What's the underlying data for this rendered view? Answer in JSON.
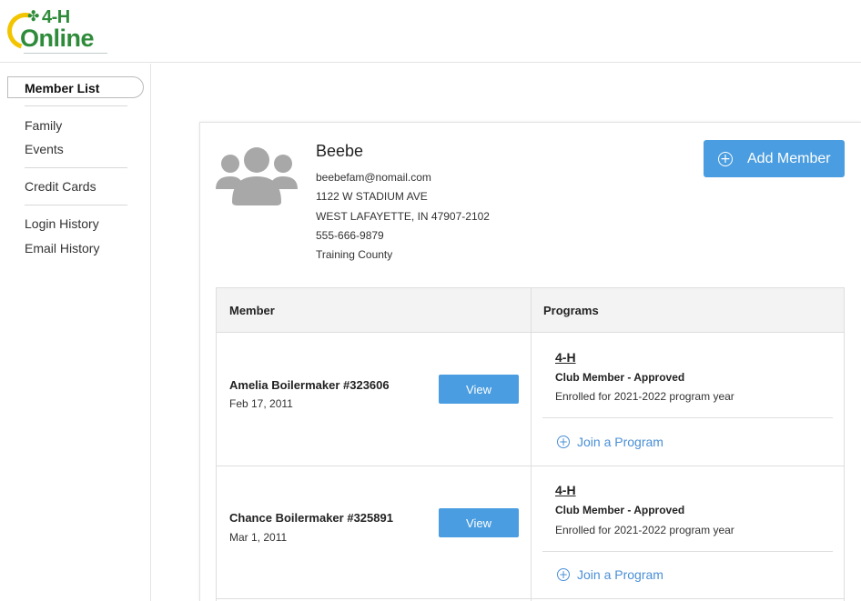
{
  "header": {
    "logo_text_top": "4-H",
    "logo_text_bottom": "Online",
    "logo_clover": "✤"
  },
  "sidebar": {
    "active_item": "Member List",
    "items": [
      "Family",
      "Events",
      "Credit Cards",
      "Login History",
      "Email History"
    ]
  },
  "family": {
    "name": "Beebe",
    "email": "beebefam@nomail.com",
    "address1": "1122 W STADIUM AVE",
    "address2": "WEST LAFAYETTE, IN 47907-2102",
    "phone": "555-666-9879",
    "county": "Training County"
  },
  "add_member": {
    "label": "Add Member",
    "icon": "plus-circle-icon"
  },
  "table": {
    "headers": [
      "Member",
      "Programs"
    ],
    "rows": [
      {
        "member": "Amelia Boilermaker #323606",
        "dob": "Feb 17, 2011",
        "view_label": "View",
        "program": "4-H",
        "status": "Club Member - Approved",
        "enrollment": "Enrolled for 2021-2022 program year",
        "join_label": "Join a Program"
      },
      {
        "member": "Chance Boilermaker #325891",
        "dob": "Mar 1, 2011",
        "view_label": "View",
        "program": "4-H",
        "status": "Club Member - Approved",
        "enrollment": "Enrolled for 2021-2022 program year",
        "join_label": "Join a Program"
      }
    ]
  },
  "colors": {
    "accent": "#4a9de0",
    "link": "#4a8fd6",
    "brand_green": "#2e8b3a",
    "brand_yellow": "#f2c500"
  }
}
